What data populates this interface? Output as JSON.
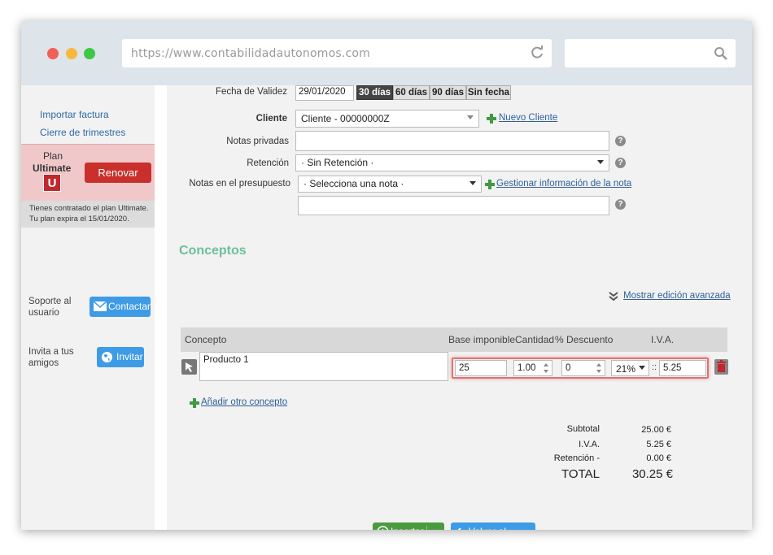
{
  "browser": {
    "url": "https://www.contabilidadautonomos.com",
    "search_placeholder": ""
  },
  "sidebar": {
    "links": [
      "Importar factura",
      "Cierre de trimestres"
    ],
    "plan": {
      "label": "Plan",
      "name": "Ultimate",
      "badge": "U",
      "renew_label": "Renovar",
      "info_line1": "Tienes contratado el plan Ultimate.",
      "info_line2": "Tu plan expira el 15/01/2020."
    },
    "support": {
      "label_line1": "Soporte al",
      "label_line2": "usuario",
      "button": "Contactar"
    },
    "invite": {
      "label_line1": "Invita a tus",
      "label_line2": "amigos",
      "button": "Invitar"
    }
  },
  "form": {
    "validity_label": "Fecha de Validez",
    "validity_date": "29/01/2020",
    "validity_options": [
      "30 días",
      "60 días",
      "90 días",
      "Sin fecha"
    ],
    "client_label": "Cliente",
    "client_value": "Cliente - 00000000Z",
    "new_client_link": "Nuevo Cliente",
    "private_notes_label": "Notas privadas",
    "private_notes_value": "",
    "retention_label": "Retención",
    "retention_value": "· Sin Retención ·",
    "budget_notes_label": "Notas en el presupuesto",
    "budget_notes_select": "· Selecciona una nota ·",
    "manage_notes_link": "Gestionar información de la nota",
    "budget_notes_value": "",
    "help_icon": "?"
  },
  "concepts": {
    "title": "Conceptos",
    "advanced_link": "Mostrar edición avanzada",
    "headers": [
      "Concepto",
      "Base imponible",
      "Cantidad",
      "% Descuento",
      "I.V.A."
    ],
    "row": {
      "concept": "Producto 1",
      "base": "25",
      "quantity": "1.00",
      "discount": "0",
      "vat_rate": "21%",
      "vat_amount": "5.25",
      "separator": "::"
    },
    "add_link": "Añadir otro concepto"
  },
  "totals": {
    "subtotal_label": "Subtotal",
    "subtotal_value": "25.00 €",
    "vat_label": "I.V.A.",
    "vat_value": "5.25 €",
    "retention_label": "Retención -",
    "retention_value": "0.00 €",
    "total_label": "TOTAL",
    "total_value": "30.25 €"
  },
  "actions": {
    "insert": "Insertar",
    "back": "Volver al listado"
  },
  "colors": {
    "accent_green": "#6cc19a",
    "danger": "#c9302c",
    "primary_blue": "#3e9be6"
  }
}
